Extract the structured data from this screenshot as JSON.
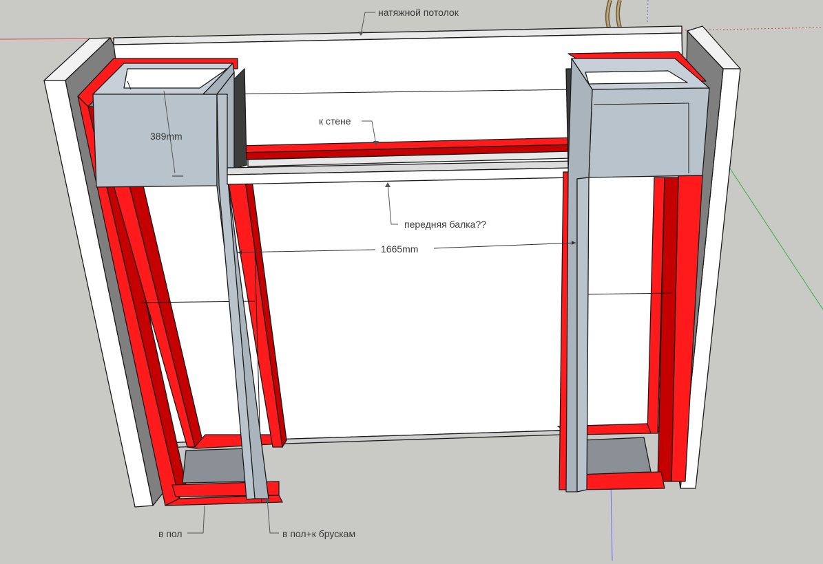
{
  "labels": {
    "ceiling": "натяжной потолок",
    "to_wall": "к стене",
    "front_beam": "передняя балка??",
    "to_floor": "в пол",
    "to_floor_bars": "в пол+к брускам"
  },
  "dimensions": {
    "height": "389mm",
    "width": "1665mm"
  },
  "colors": {
    "background": "#c9c9c6",
    "red_frame": "#ff0000",
    "drywall_blue": "#b8c3cc",
    "panel_white": "#ffffff",
    "wall_grey": "#7e7e7e",
    "floor_grey": "#8a9096"
  }
}
